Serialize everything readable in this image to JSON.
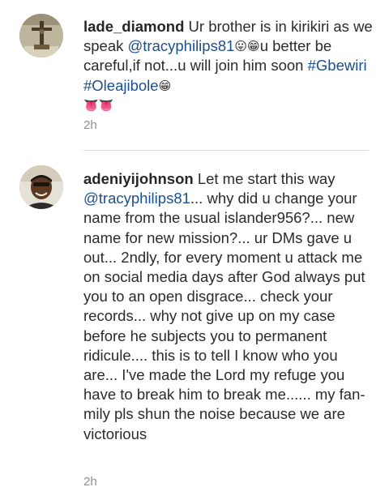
{
  "comments": [
    {
      "username": "lade_diamond",
      "text_a": " Ur brother is in kirikiri as we speak ",
      "mention": "@tracyphilips81",
      "emoji_1": "😛😁",
      "text_b": "u better be careful,if not...u will join him soon ",
      "hashtag_1": "#Gbewiri",
      "hashtag_2": "#Oleajibole",
      "emoji_2": "😁",
      "emoji_3": "👅👅",
      "timestamp": "2h",
      "avatar_icon": "crucifix-avatar-icon"
    },
    {
      "username": "adeniyijohnson",
      "text_a": " Let me start this way ",
      "mention": "@tracyphilips81",
      "text_b": "... why did u change your name from the usual islander956?... new name for new mission?... ur DMs gave u out... 2ndly, for every moment u attack me on social media days after God always put you to an open disgrace... check your records... why not give up on my case before he subjects you to permanent ridicule.... this is to tell I know who you are... I've made the Lord my refuge you have to break him to break me...... my fan-mily pls shun the noise because we are victorious",
      "timestamp": "2h",
      "avatar_icon": "man-portrait-avatar-icon"
    }
  ],
  "colors": {
    "text": "#262626",
    "link": "#1c4f8f",
    "muted": "#8e8e8e",
    "divider": "#dbdbdb"
  }
}
